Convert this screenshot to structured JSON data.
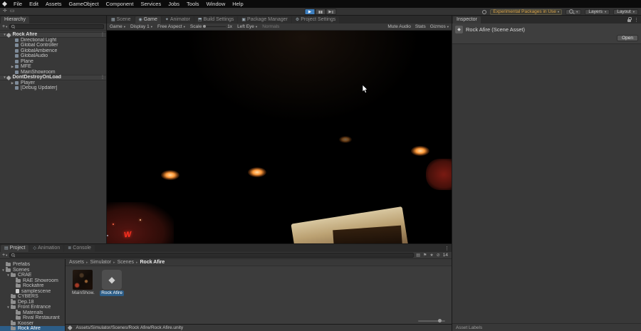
{
  "colors": {
    "accent_blue": "#3e7fbf",
    "selection_blue": "#2c5d87",
    "warning_orange": "#d8a34a"
  },
  "menu_bar": {
    "items": [
      "File",
      "Edit",
      "Assets",
      "GameObject",
      "Component",
      "Services",
      "Jobs",
      "Tools",
      "Window",
      "Help"
    ]
  },
  "toolbar": {
    "experimental_packages": "Experimental Packages in Use",
    "layers": "Layers",
    "layout": "Layout"
  },
  "hierarchy": {
    "tab_title": "Hierarchy",
    "rows": [
      {
        "label": "Rock Afire",
        "type": "scene",
        "arrow": "down"
      },
      {
        "label": "Directional Light",
        "type": "item"
      },
      {
        "label": "Global Controller",
        "type": "item"
      },
      {
        "label": "GlobalAmbience",
        "type": "item"
      },
      {
        "label": "GlobalAudio",
        "type": "item"
      },
      {
        "label": "Plane",
        "type": "item"
      },
      {
        "label": "MFE",
        "type": "item",
        "arrow": "right"
      },
      {
        "label": "MainShowroom",
        "type": "item"
      },
      {
        "label": "DontDestroyOnLoad",
        "type": "scene",
        "arrow": "down"
      },
      {
        "label": "Player",
        "type": "item",
        "arrow": "right"
      },
      {
        "label": "[Debug Updater]",
        "type": "item"
      }
    ]
  },
  "center_tabs": [
    {
      "label": "Scene",
      "icon": "scene",
      "active": false
    },
    {
      "label": "Game",
      "icon": "game",
      "active": true
    },
    {
      "label": "Animator",
      "icon": "animator",
      "active": false
    },
    {
      "label": "Build Settings",
      "icon": "build",
      "active": false
    },
    {
      "label": "Package Manager",
      "icon": "package",
      "active": false
    },
    {
      "label": "Project Settings",
      "icon": "settings",
      "active": false
    }
  ],
  "game_toolbar": {
    "display_mode": "Game",
    "display": "Display 1",
    "aspect": "Free Aspect",
    "scale_label": "Scale",
    "scale_value": "1x",
    "eye": "Left Eye",
    "normals": "Normals",
    "mute": "Mute Audio",
    "stats": "Stats",
    "gizmos": "Gizmos"
  },
  "game_view": {
    "sign_text": "W"
  },
  "inspector": {
    "tab_title": "Inspector",
    "asset_title": "Rock Afire (Scene Asset)",
    "open_button": "Open",
    "asset_labels": "Asset Labels"
  },
  "project": {
    "tabs": [
      {
        "label": "Project",
        "active": true
      },
      {
        "label": "Animation",
        "active": false
      },
      {
        "label": "Console",
        "active": false
      }
    ],
    "hidden_count": "14",
    "tree": [
      {
        "label": "Prefabs",
        "depth": 1,
        "icon": "folder"
      },
      {
        "label": "Scenes",
        "depth": 1,
        "icon": "folder",
        "arrow": "down"
      },
      {
        "label": "CRAE",
        "depth": 2,
        "icon": "folder",
        "arrow": "down"
      },
      {
        "label": "RAE Showroom",
        "depth": 3,
        "icon": "folder"
      },
      {
        "label": "Rockafire",
        "depth": 3,
        "icon": "folder"
      },
      {
        "label": "samplescene",
        "depth": 3,
        "icon": "file"
      },
      {
        "label": "CYBERS",
        "depth": 2,
        "icon": "folder"
      },
      {
        "label": "Dep.18",
        "depth": 2,
        "icon": "folder"
      },
      {
        "label": "Front Entrance",
        "depth": 2,
        "icon": "folder",
        "arrow": "down"
      },
      {
        "label": "Materials",
        "depth": 3,
        "icon": "folder"
      },
      {
        "label": "Rival Restaurant",
        "depth": 3,
        "icon": "folder"
      },
      {
        "label": "Kooser",
        "depth": 2,
        "icon": "folder"
      },
      {
        "label": "Rock Afire",
        "depth": 2,
        "icon": "folder",
        "selected": true
      }
    ],
    "breadcrumbs": [
      "Assets",
      "Simulator",
      "Scenes",
      "Rock Afire"
    ],
    "items": [
      {
        "label": "MainShow...",
        "kind": "prefab",
        "selected": false
      },
      {
        "label": "Rock Afire",
        "kind": "scene",
        "selected": true
      }
    ],
    "status_path": "Assets/Simulator/Scenes/Rock Afire/Rock Afire.unity"
  }
}
